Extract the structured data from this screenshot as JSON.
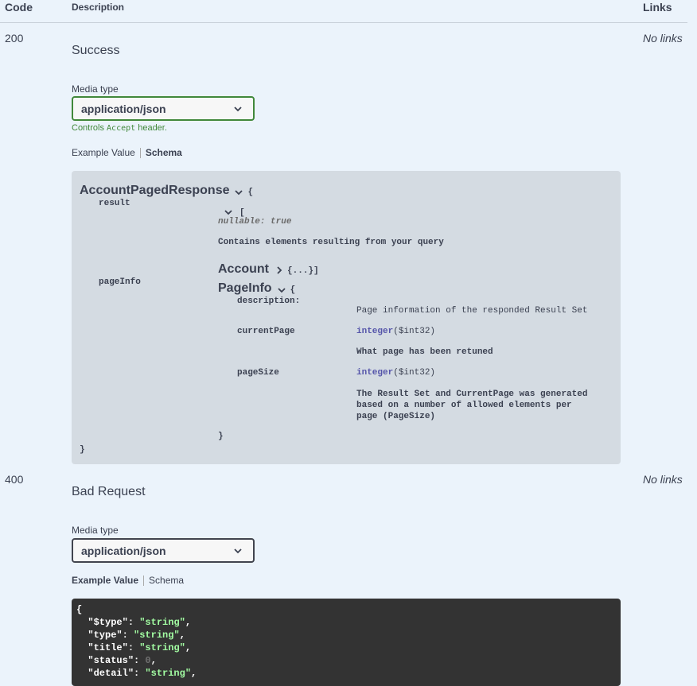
{
  "table": {
    "headers": {
      "code": "Code",
      "description": "Description",
      "links": "Links"
    }
  },
  "responses": [
    {
      "code": "200",
      "description": "Success",
      "links": "No links",
      "media_type_label": "Media type",
      "media_type": "application/json",
      "controls_text_before": "Controls ",
      "controls_code": "Accept",
      "controls_text_after": " header.",
      "tabs": {
        "example": "Example Value",
        "schema": "Schema",
        "active": "Schema"
      },
      "schema": {
        "model_name": "AccountPagedResponse",
        "open_brace": "{",
        "close_brace": "}",
        "props": {
          "result": {
            "name": "result",
            "open_bracket": "[",
            "nullable": "nullable: true",
            "description": "Contains elements resulting from your query",
            "item_model": "Account",
            "item_collapsed": "{...}]"
          },
          "pageInfo": {
            "name": "pageInfo",
            "model_name": "PageInfo",
            "open_brace": "{",
            "close_brace": "}",
            "props": [
              {
                "name": "description:",
                "type": "",
                "format": "",
                "desc": "Page information of the responded Result Set"
              },
              {
                "name": "currentPage",
                "type": "integer",
                "format": "($int32)",
                "desc": "What page has been retuned"
              },
              {
                "name": "pageSize",
                "type": "integer",
                "format": "($int32)",
                "desc_lines": [
                  "The Result Set and CurrentPage was generated",
                  "based on a number of allowed elements per",
                  "page (PageSize)"
                ]
              }
            ]
          }
        }
      }
    },
    {
      "code": "400",
      "description": "Bad Request",
      "links": "No links",
      "media_type_label": "Media type",
      "media_type": "application/json",
      "tabs": {
        "example": "Example Value",
        "schema": "Schema",
        "active": "Example Value"
      },
      "example_json": {
        "open": "{",
        "lines": [
          {
            "key": "\"$type\"",
            "value": "\"string\"",
            "kind": "string"
          },
          {
            "key": "\"type\"",
            "value": "\"string\"",
            "kind": "string"
          },
          {
            "key": "\"title\"",
            "value": "\"string\"",
            "kind": "string"
          },
          {
            "key": "\"status\"",
            "value": "0",
            "kind": "number"
          },
          {
            "key": "\"detail\"",
            "value": "\"string\"",
            "kind": "string"
          }
        ]
      }
    }
  ],
  "colors": {
    "background": "#ebf3fb",
    "accent_green": "#41883a",
    "model_box": "#d4dbe2",
    "code_box": "#333333",
    "json_string": "#a2fca2",
    "type_blue": "#5555aa"
  }
}
